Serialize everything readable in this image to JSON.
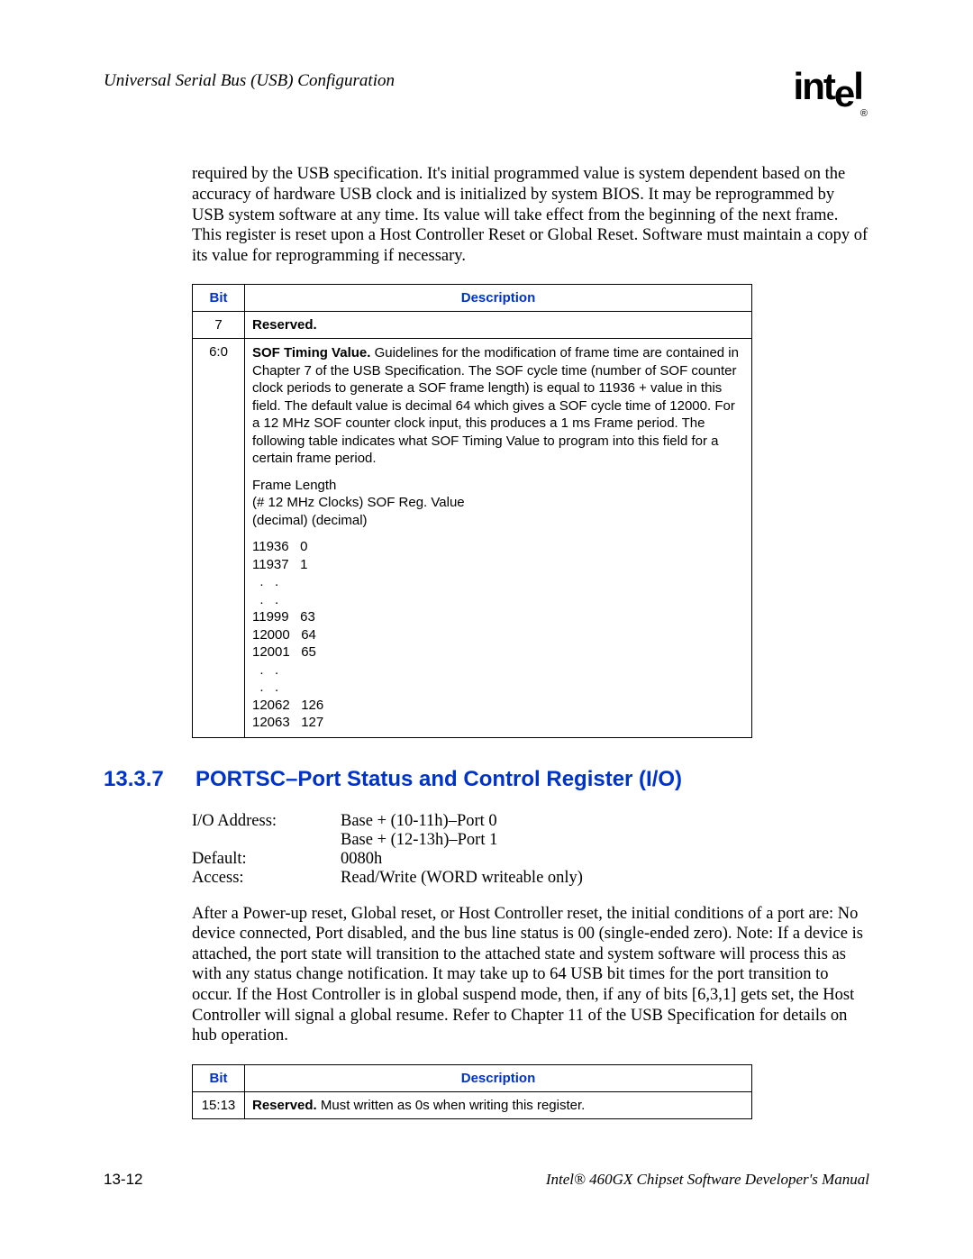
{
  "header": {
    "left": "Universal Serial Bus (USB) Configuration",
    "logo_text_1": "int",
    "logo_text_2": "e",
    "logo_text_3": "l",
    "logo_reg": "®"
  },
  "intro_para": "required by the USB specification. It's initial programmed value is system dependent based on the accuracy of hardware USB clock and is initialized by system BIOS. It may be reprogrammed by USB system software at any time. Its value will take effect from the beginning of the next frame. This register is reset upon a Host Controller Reset or Global Reset. Software must maintain a copy of its value for reprogramming if necessary.",
  "table1": {
    "headers": {
      "bit": "Bit",
      "desc": "Description"
    },
    "rows": [
      {
        "bit": "7",
        "desc_bold": "Reserved.",
        "desc_rest": ""
      },
      {
        "bit": "6:0",
        "desc_bold": "SOF Timing Value.",
        "desc_rest": " Guidelines for the modification of frame time are contained in Chapter 7 of the USB Specification. The SOF cycle time (number of SOF counter clock periods to generate a SOF frame length) is equal to 11936 + value in this field. The default value is decimal 64 which gives a SOF cycle time of 12000. For a 12 MHz SOF counter clock input, this produces a 1 ms Frame period. The following table indicates what SOF Timing Value to program into this field for a certain frame period.",
        "subhead1": "Frame Length",
        "subhead2": "(# 12 MHz Clocks) SOF Reg. Value",
        "subhead3": "(decimal)  (decimal)",
        "pairs": [
          "11936   0",
          "11937   1",
          "  .   .",
          "  .   .",
          "11999   63",
          "12000   64",
          "12001   65",
          "  .   .",
          "  .   .",
          "12062   126",
          "12063   127"
        ]
      }
    ]
  },
  "section": {
    "num": "13.3.7",
    "title": "PORTSC–Port Status and Control Register (I/O)"
  },
  "info": {
    "rows": [
      {
        "label": "I/O Address:",
        "value": "Base + (10-11h)–Port 0"
      },
      {
        "label": "",
        "value": "Base + (12-13h)–Port 1"
      },
      {
        "label": "Default:",
        "value": "0080h"
      },
      {
        "label": "Access:",
        "value": "Read/Write (WORD writeable only)"
      }
    ]
  },
  "para2": "After a Power-up reset, Global reset, or Host Controller reset, the initial conditions of a port are: No device connected, Port disabled, and the bus line status is 00 (single-ended zero). Note: If a device is attached, the port state will transition to the attached state and system software will process this as with any status change notification. It may take up to 64 USB bit times for the port transition to occur. If the Host Controller is in global suspend mode, then, if any of bits [6,3,1] gets set, the Host Controller will signal a global resume. Refer to Chapter 11 of the USB Specification for details on hub operation.",
  "table2": {
    "headers": {
      "bit": "Bit",
      "desc": "Description"
    },
    "rows": [
      {
        "bit": "15:13",
        "desc_bold": "Reserved.",
        "desc_rest": " Must written as 0s when writing this register."
      }
    ]
  },
  "footer": {
    "left": "13-12",
    "right": "Intel® 460GX Chipset Software Developer's Manual"
  }
}
